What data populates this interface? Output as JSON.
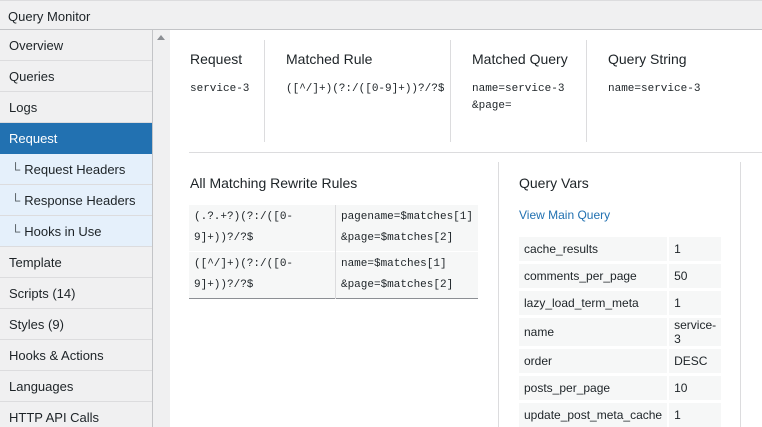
{
  "app": {
    "title": "Query Monitor"
  },
  "sidebar": {
    "items": [
      {
        "label": "Overview",
        "sub": false,
        "active": false
      },
      {
        "label": "Queries",
        "sub": false,
        "active": false
      },
      {
        "label": "Logs",
        "sub": false,
        "active": false
      },
      {
        "label": "Request",
        "sub": false,
        "active": true
      },
      {
        "label": "Request Headers",
        "sub": true,
        "active": false
      },
      {
        "label": "Response Headers",
        "sub": true,
        "active": false
      },
      {
        "label": "Hooks in Use",
        "sub": true,
        "active": false
      },
      {
        "label": "Template",
        "sub": false,
        "active": false
      },
      {
        "label": "Scripts (14)",
        "sub": false,
        "active": false
      },
      {
        "label": "Styles (9)",
        "sub": false,
        "active": false
      },
      {
        "label": "Hooks & Actions",
        "sub": false,
        "active": false
      },
      {
        "label": "Languages",
        "sub": false,
        "active": false
      },
      {
        "label": "HTTP API Calls",
        "sub": false,
        "active": false
      }
    ],
    "branch_glyph": "└"
  },
  "request": {
    "columns": [
      {
        "heading": "Request",
        "lines": [
          "service-3"
        ]
      },
      {
        "heading": "Matched Rule",
        "lines": [
          "([^/]+)(?:/([0-9]+))?/?$"
        ]
      },
      {
        "heading": "Matched Query",
        "lines": [
          "name=service-3",
          "&page="
        ]
      },
      {
        "heading": "Query String",
        "lines": [
          "name=service-3"
        ]
      }
    ]
  },
  "rewrite_rules": {
    "title": "All Matching Rewrite Rules",
    "rows": [
      {
        "pattern": "(.?.+?)(?:/([0-9]+))?/?$",
        "replacement": [
          "pagename=$matches[1]",
          "&page=$matches[2]"
        ]
      },
      {
        "pattern": "([^/]+)(?:/([0-9]+))?/?$",
        "replacement": [
          "name=$matches[1]",
          "&page=$matches[2]"
        ]
      }
    ]
  },
  "query_vars": {
    "title": "Query Vars",
    "link": "View Main Query",
    "rows": [
      {
        "key": "cache_results",
        "value": "1"
      },
      {
        "key": "comments_per_page",
        "value": "50"
      },
      {
        "key": "lazy_load_term_meta",
        "value": "1"
      },
      {
        "key": "name",
        "value": "service-3"
      },
      {
        "key": "order",
        "value": "DESC"
      },
      {
        "key": "posts_per_page",
        "value": "10"
      },
      {
        "key": "update_post_meta_cache",
        "value": "1"
      }
    ]
  },
  "colors": {
    "accent": "#2271b1",
    "sub_bg": "#e5f0fb",
    "sidebar_bg": "#f0f0f1"
  }
}
